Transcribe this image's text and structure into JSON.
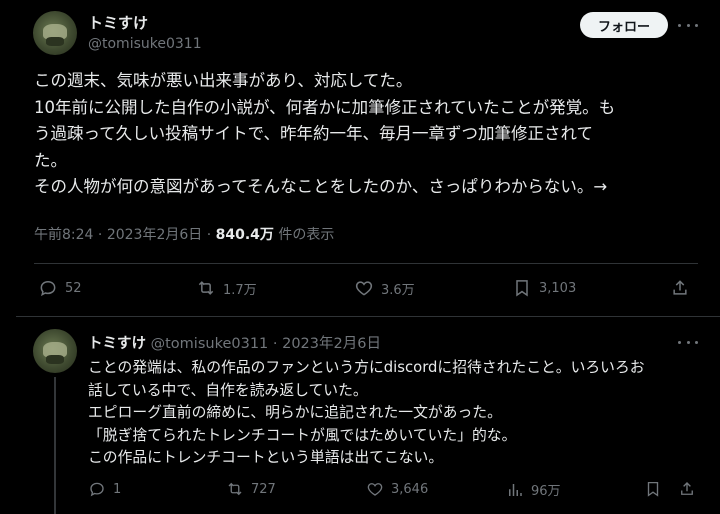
{
  "main_tweet": {
    "display_name": "トミすけ",
    "handle": "@tomisuke0311",
    "follow_label": "フォロー",
    "lines": [
      "この週末、気味が悪い出来事があり、対応してた。",
      "10年前に公開した自作の小説が、何者かに加筆修正されていたことが発覚。も",
      "う過疎って久しい投稿サイトで、昨年約一年、毎月一章ずつ加筆修正されて",
      "た。",
      "その人物が何の意図があってそんなことをしたのか、さっぱりわからない。→"
    ],
    "time": "午前8:24",
    "date": "2023年2月6日",
    "views": "840.4万",
    "views_suffix": "件の表示",
    "stats": {
      "replies": "52",
      "reposts": "1.7万",
      "likes": "3.6万",
      "bookmarks": "3,103"
    }
  },
  "reply_tweet": {
    "display_name": "トミすけ",
    "handle": "@tomisuke0311",
    "date": "2023年2月6日",
    "lines": [
      "ことの発端は、私の作品のファンという方にdiscordに招待されたこと。いろいろお",
      "話している中で、自作を読み返していた。",
      "エピローグ直前の締めに、明らかに追記された一文があった。",
      "「脱ぎ捨てられたトレンチコートが風ではためいていた」的な。",
      "この作品にトレンチコートという単語は出てこない。"
    ],
    "stats": {
      "replies": "1",
      "reposts": "727",
      "likes": "3,646",
      "views": "96万"
    }
  },
  "icons": {
    "reply": "reply-icon",
    "repost": "repost-icon",
    "like": "heart-icon",
    "bookmark": "bookmark-icon",
    "share": "share-icon",
    "views": "views-icon",
    "more": "more-icon"
  },
  "colors": {
    "background": "#000000",
    "text": "#e7e9ea",
    "secondary": "#71767b",
    "divider": "#2f3336",
    "button_bg": "#eff3f4"
  }
}
